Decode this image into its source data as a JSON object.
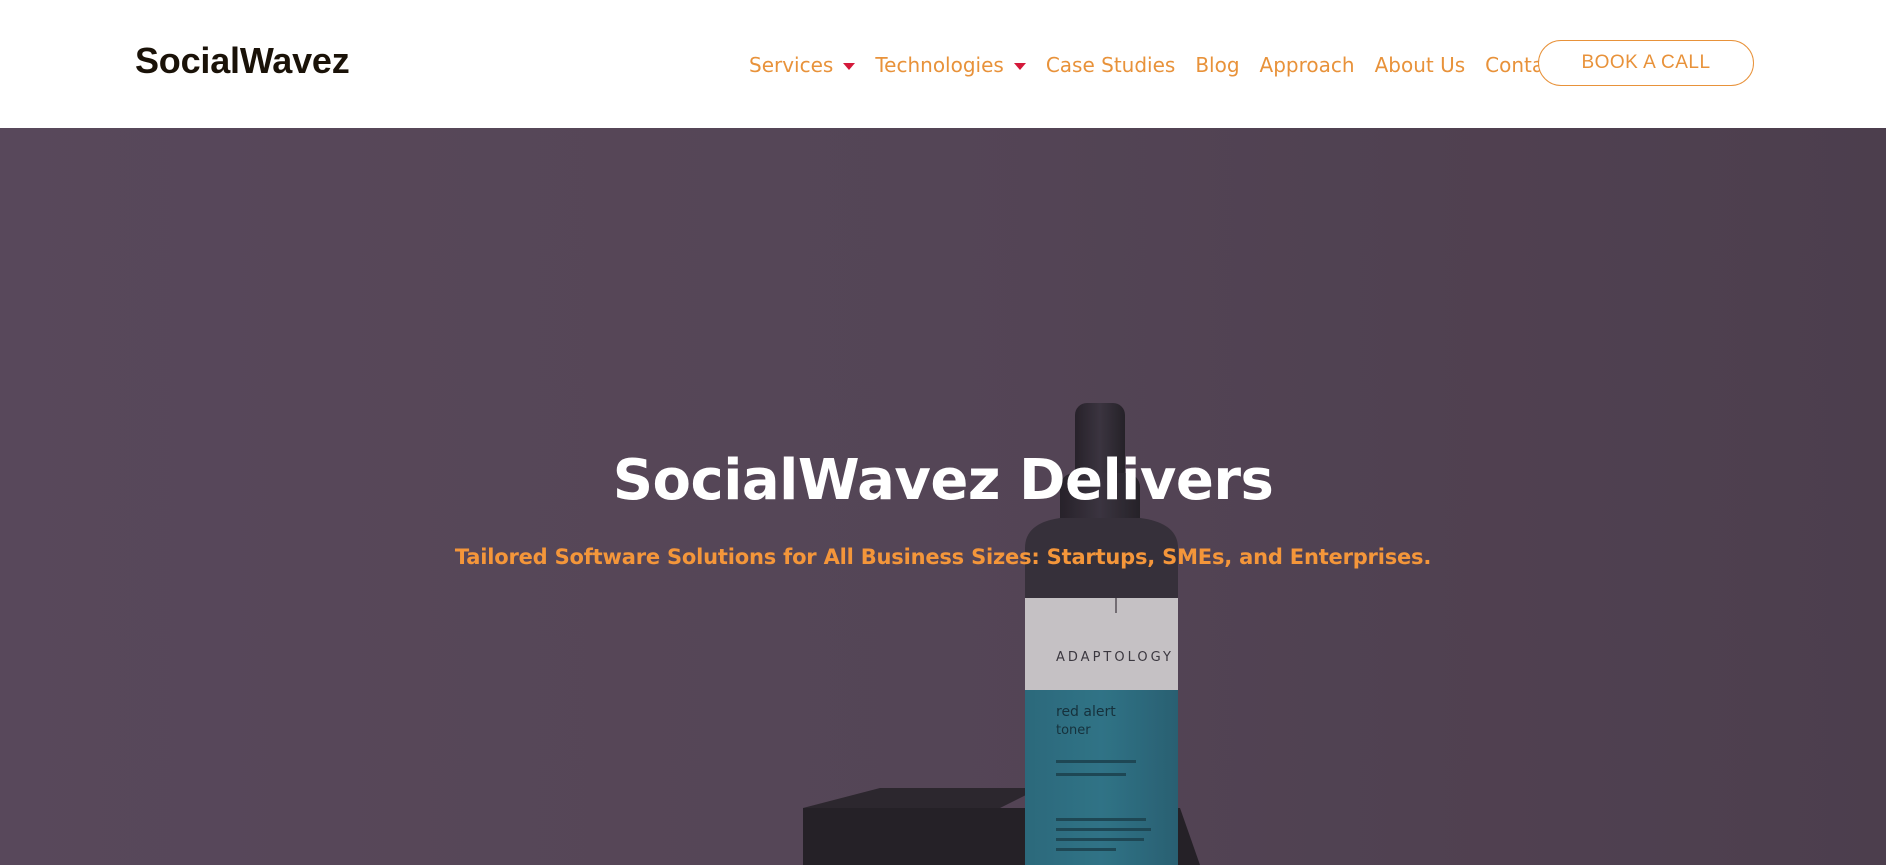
{
  "header": {
    "logo": "SocialWavez",
    "nav": [
      {
        "label": "Services",
        "has_dropdown": true
      },
      {
        "label": "Technologies",
        "has_dropdown": true
      },
      {
        "label": "Case Studies",
        "has_dropdown": false
      },
      {
        "label": "Blog",
        "has_dropdown": false
      },
      {
        "label": "Approach",
        "has_dropdown": false
      },
      {
        "label": "About Us",
        "has_dropdown": false
      },
      {
        "label": "Contact",
        "has_dropdown": false
      }
    ],
    "cta_label": "BOOK A CALL"
  },
  "hero": {
    "title": "SocialWavez Delivers",
    "subtitle": "Tailored Software Solutions for All Business Sizes: Startups, SMEs, and Enterprises.",
    "product_brand": "ADAPTOLOGY",
    "product_name": "red alert\ntoner"
  },
  "colors": {
    "accent": "#e8923a",
    "caret": "#d4193a",
    "hero_overlay": "#574858",
    "logo_text": "#1a1208"
  }
}
